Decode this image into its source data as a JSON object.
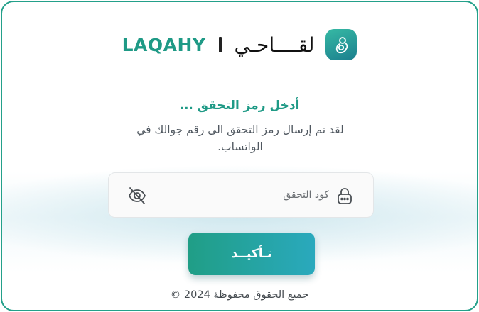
{
  "brand": {
    "latin_name": "LAQAHY",
    "arabic_name": "لقــــاحـي",
    "logo_icon": "mother-baby-icon"
  },
  "verification": {
    "title": "أدخل رمز التحقق ...",
    "subtitle": "لقد تم إرسال رمز التحقق الى رقم جوالك في الواتساب.",
    "code_field": {
      "placeholder": "كود التحقق",
      "value": "",
      "leading_icon": "lock-icon",
      "toggle_icon": "eye-off-icon"
    },
    "confirm_label": "تـأكيــد"
  },
  "footer": {
    "copyright": "جميع الحقوق محفوظة 2024 ©"
  },
  "colors": {
    "brand_green": "#1f9a86",
    "button_gradient_start": "#209e86",
    "button_gradient_end": "#2aa9bd",
    "frame_border": "#23a08a"
  }
}
